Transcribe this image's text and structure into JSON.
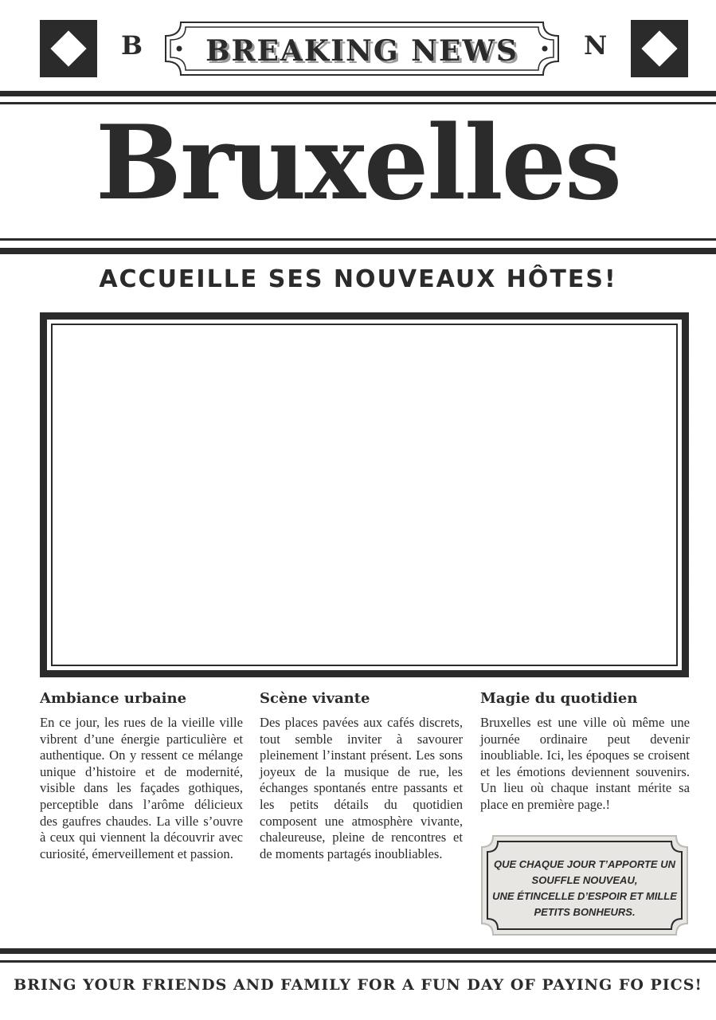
{
  "header": {
    "left_letter": "B",
    "right_letter": "N",
    "badge": "BREAKING NEWS",
    "left_icon": "diamond-icon",
    "right_icon": "diamond-icon"
  },
  "title": "Bruxelles",
  "subtitle": "ACCUEILLE SES NOUVEAUX HÔTES!",
  "columns": [
    {
      "heading": "Ambiance urbaine",
      "body": "En ce jour, les rues de la vieille ville vibrent d’une énergie particulière et authentique. On y ressent ce mélange unique d’histoire et de modernité, visible dans les façades gothiques, perceptible dans l’arôme délicieux des gaufres chaudes. La ville s’ouvre à ceux qui viennent la découvrir avec curiosité, émerveillement et passion."
    },
    {
      "heading": "Scène vivante",
      "body": "Des places pavées aux cafés discrets, tout semble inviter à savourer pleinement l’instant présent. Les sons joyeux de la musique de rue, les échanges spontanés entre passants et les petits détails du quotidien composent une atmosphère vivante, chaleureuse, pleine de rencontres et de moments partagés inoubliables."
    },
    {
      "heading": "Magie du quotidien",
      "body": "Bruxelles est une ville où même une journée ordinaire peut devenir inoubliable. Ici, les époques se croisent et les émotions deviennent souvenirs. Un lieu où chaque instant mérite sa place en première page.!"
    }
  ],
  "quote": {
    "line1": "Que chaque jour t’apporte un",
    "line2": "souffle nouveau,",
    "line3": "une étincelle d’espoir et mille",
    "line4": "petits bonheurs."
  },
  "footer": "BRING YOUR FRIENDS AND FAMILY FOR A FUN DAY OF PAYING FO PICS!",
  "colors": {
    "ink": "#2b2b2b",
    "quote_bg": "#e8e6e2"
  }
}
